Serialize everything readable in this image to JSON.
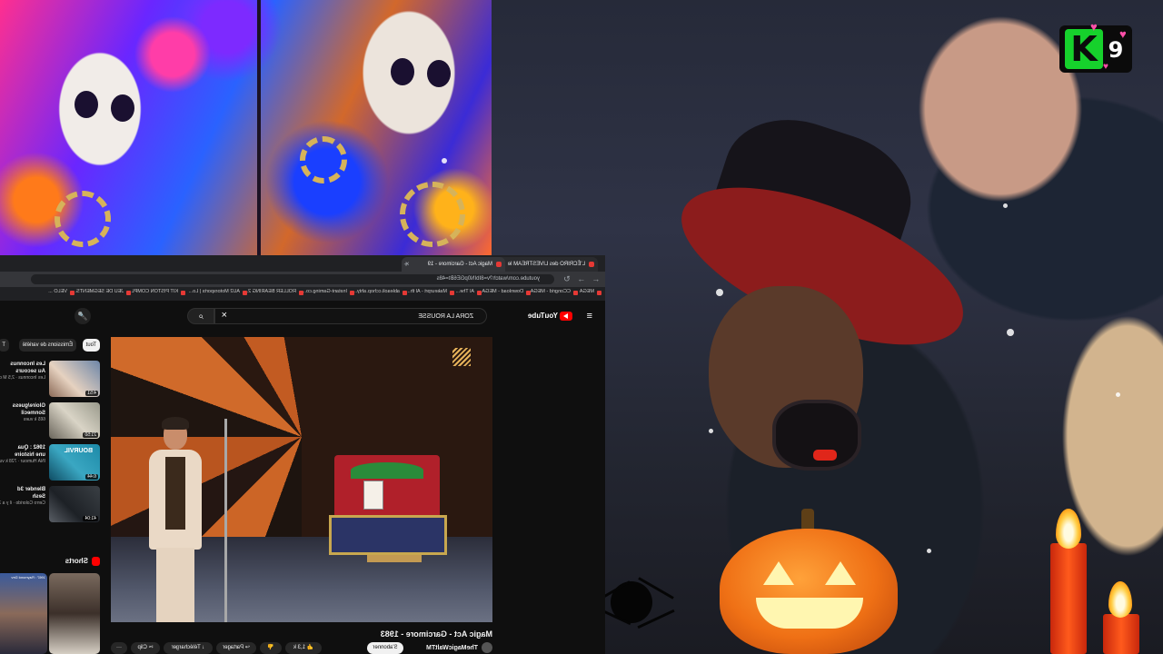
{
  "logo": {
    "letter": "K",
    "number": "9"
  },
  "browser": {
    "tabs": [
      {
        "label": "L'ÉCRIRO des LIVESTREAM le"
      },
      {
        "label": "Magic Act - Garcimore - 19"
      }
    ],
    "address": "youtube.com/watch?v=8IbIN0pGE6Bt=48s",
    "bookmarks": [
      "MEGA",
      "CCongrid - MEGA",
      "Download - MEGA",
      "Al The...",
      "Makeurprt - Al th...",
      "ableaoli.cchop.ahty...",
      "Instant-Gaming.co...",
      "ROLLER BEARING 2...",
      "AU2 Motorsports | Lo...",
      "KIT PISTON COMPL...",
      "JEU DE SEGMENTS...",
      "VELO ..."
    ]
  },
  "youtube": {
    "logo_text": "YouTube",
    "search_query": "ZORA LA ROUSSE",
    "video_title": "Magic Act - Garcimore - 1983",
    "channel": "TheMagicWaltTM",
    "subscribe": "S'abonner",
    "actions": {
      "likes": "1,3 k",
      "share": "Partager",
      "download": "Télécharger",
      "clip": "Clip",
      "more": "···"
    },
    "chips": [
      "Tout",
      "Émissions de variété",
      "T"
    ],
    "recommendations": [
      {
        "title": "Les Inconnus",
        "subtitle": "Au secours",
        "meta": "Les Inconnus · 2,5 M de vues",
        "duration": "4:51"
      },
      {
        "title": "Gloire/guess",
        "subtitle": "Sonmecil",
        "meta": "665 k vues",
        "duration": "21:50"
      },
      {
        "title": "1962 : Qua",
        "subtitle": "une histoire",
        "meta": "INA Humour · 728 k vues",
        "duration": "6:44",
        "badge": "BOURVIL"
      },
      {
        "title": "Blender 3d",
        "subtitle": "Sesh",
        "meta": "Cerro Colorido · il y a 7 mois",
        "duration": "41:04"
      }
    ],
    "shorts_label": "Shorts",
    "shorts": [
      {
        "caption": ""
      },
      {
        "caption": "1967 : Raymond Dev"
      }
    ]
  }
}
